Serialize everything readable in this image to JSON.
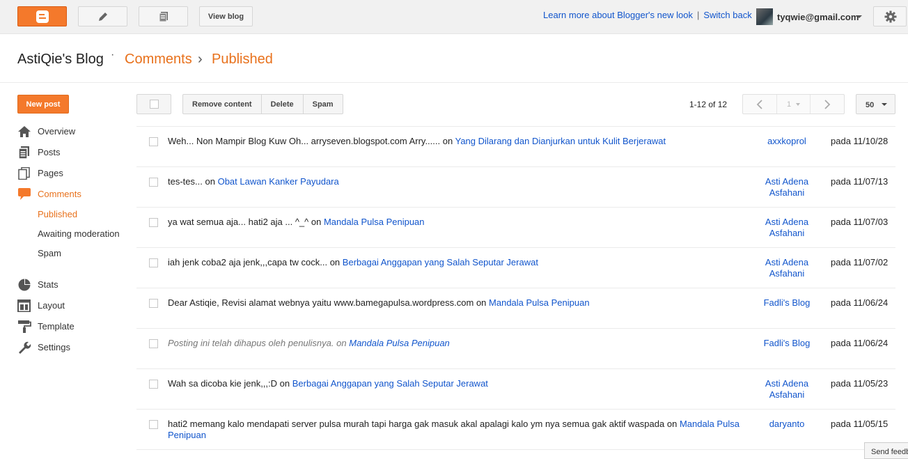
{
  "topbar": {
    "view_blog": "View blog",
    "learn_more": "Learn more about Blogger's new look",
    "separator": "|",
    "switch_back": "Switch back",
    "email": "tyqwie@gmail.com",
    "brand_color": "#f4792b"
  },
  "breadcrumb": {
    "blog": "AstiQie's Blog",
    "dot": "·",
    "section": "Comments",
    "arrow": "›",
    "current": "Published"
  },
  "sidebar": {
    "new_post": "New post",
    "items": [
      {
        "label": "Overview",
        "icon": "home-icon"
      },
      {
        "label": "Posts",
        "icon": "posts-icon"
      },
      {
        "label": "Pages",
        "icon": "pages-icon"
      },
      {
        "label": "Comments",
        "icon": "comment-icon",
        "active": true
      },
      {
        "label": "Stats",
        "icon": "pie-chart-icon"
      },
      {
        "label": "Layout",
        "icon": "layout-icon"
      },
      {
        "label": "Template",
        "icon": "paint-roller-icon"
      },
      {
        "label": "Settings",
        "icon": "wrench-icon"
      }
    ],
    "sub_items": [
      {
        "label": "Published",
        "active": true
      },
      {
        "label": "Awaiting moderation"
      },
      {
        "label": "Spam"
      }
    ]
  },
  "toolbar": {
    "remove_content": "Remove content",
    "delete": "Delete",
    "spam": "Spam",
    "page_count": "1-12 of 12",
    "page": "1",
    "per_page": "50"
  },
  "comments": [
    {
      "body": "Weh... Non Mampir Blog Kuw Oh... arryseven.blogspot.com Arry......",
      "on": "on",
      "post": "Yang Dilarang dan Dianjurkan untuk Kulit Berjerawat",
      "author": "axxkoprol",
      "date": "pada 11/10/28"
    },
    {
      "body": "tes-tes...",
      "on": "on",
      "post": "Obat Lawan Kanker Payudara",
      "author": "Asti Adena Asfahani",
      "date": "pada 11/07/13"
    },
    {
      "body": "ya wat semua aja... hati2 aja ... ^_^",
      "on": "on",
      "post": "Mandala Pulsa Penipuan",
      "author": "Asti Adena Asfahani",
      "date": "pada 11/07/03"
    },
    {
      "body": "iah jenk coba2 aja jenk,,,capa tw cock...",
      "on": "on",
      "post": "Berbagai Anggapan yang Salah Seputar Jerawat",
      "author": "Asti Adena Asfahani",
      "date": "pada 11/07/02"
    },
    {
      "body": "Dear Astiqie, Revisi alamat webnya yaitu www.bamegapulsa.wordpress.com",
      "on": "on",
      "post": "Mandala Pulsa Penipuan",
      "author": "Fadli's Blog",
      "date": "pada 11/06/24"
    },
    {
      "body": "Posting ini telah dihapus oleh penulisnya.",
      "on": "on",
      "post": "Mandala Pulsa Penipuan",
      "author": "Fadli's Blog",
      "date": "pada 11/06/24",
      "deleted": true
    },
    {
      "body": "Wah sa dicoba kie jenk,,,:D",
      "on": "on",
      "post": "Berbagai Anggapan yang Salah Seputar Jerawat",
      "author": "Asti Adena Asfahani",
      "date": "pada 11/05/23"
    },
    {
      "body": "hati2 memang kalo mendapati server pulsa murah tapi harga gak masuk akal apalagi kalo ym nya semua gak aktif waspada",
      "on": "on",
      "post": "Mandala Pulsa Penipuan",
      "author": "daryanto",
      "date": "pada 11/05/15"
    }
  ],
  "feedback": "Send feedback"
}
